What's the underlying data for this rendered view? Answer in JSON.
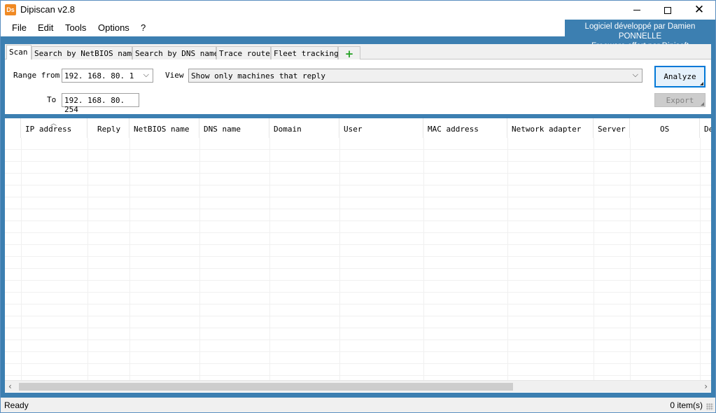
{
  "window": {
    "title": "Dipiscan v2.8",
    "icon": "dipiscan-app-icon",
    "icon_text": "Ds",
    "controls": [
      "minimize",
      "maximize",
      "close"
    ],
    "close_glyph": "✕"
  },
  "menu": {
    "items": [
      "File",
      "Edit",
      "Tools",
      "Options",
      "?"
    ]
  },
  "credits": {
    "line1": "Logiciel développé par Damien PONNELLE",
    "line2": "Freeware offert par Dipisoft"
  },
  "tabs": [
    {
      "label": "Scan",
      "active": true
    },
    {
      "label": "Search by NetBIOS name"
    },
    {
      "label": "Search by DNS name"
    },
    {
      "label": "Trace route"
    },
    {
      "label": "Fleet tracking"
    },
    {
      "label": "+",
      "icon": "plus-icon"
    }
  ],
  "scan": {
    "range_from_label": "Range from",
    "range_from_value": "192. 168. 80. 1",
    "to_label": "To",
    "to_value": "192. 168. 80. 254",
    "view_label": "View",
    "view_value": "Show only machines that reply",
    "analyze_label": "Analyze",
    "export_label": "Export"
  },
  "grid": {
    "columns": [
      "IP address",
      "Reply",
      "NetBIOS name",
      "DNS name",
      "Domain",
      "User",
      "MAC address",
      "Network adapter",
      "Server",
      "OS",
      "De"
    ],
    "sorted_column": "IP address",
    "rows": []
  },
  "status": {
    "left": "Ready",
    "right": "0 item(s)"
  },
  "colors": {
    "frame": "#3c7fb1",
    "accent": "#0078d7",
    "plus": "#22a022"
  }
}
